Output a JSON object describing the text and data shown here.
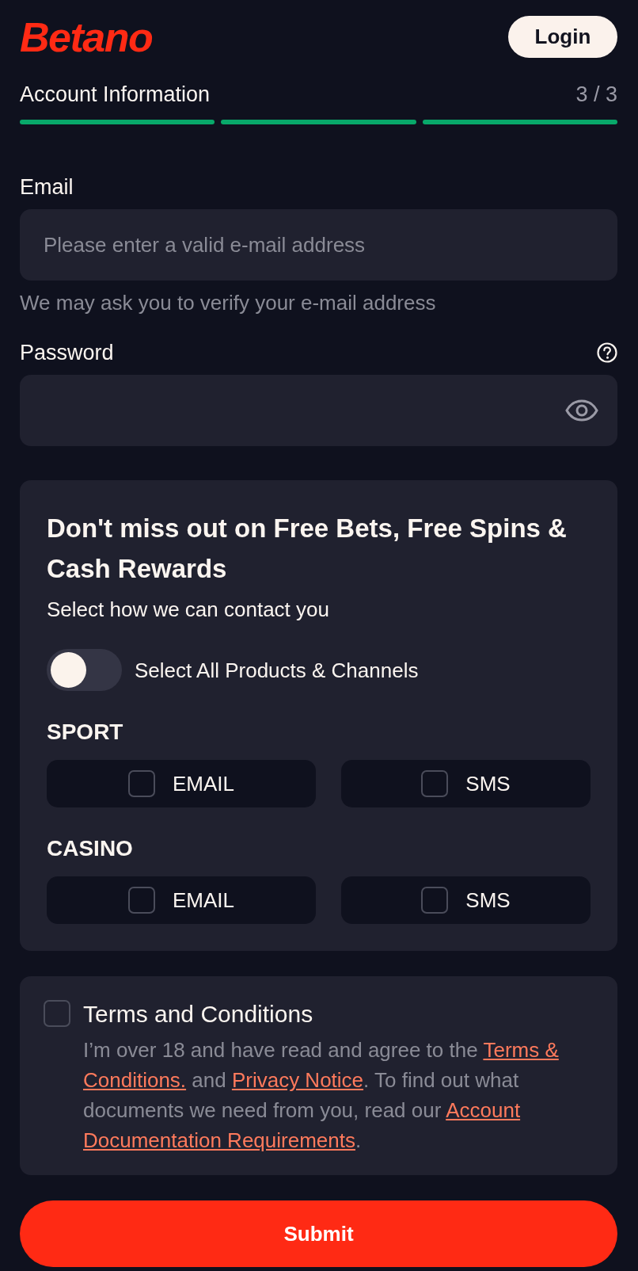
{
  "header": {
    "logo": "Betano",
    "login_button": "Login"
  },
  "progress": {
    "title": "Account Information",
    "counter": "3 / 3",
    "steps": [
      {
        "done": true
      },
      {
        "done": true
      },
      {
        "done": true
      }
    ]
  },
  "fields": [
    {
      "kind": "email",
      "label": "Email",
      "placeholder": "Please enter a valid e-mail address",
      "hint": "We may ask you to verify your e-mail address"
    },
    {
      "kind": "password",
      "label": "Password"
    }
  ],
  "promo": {
    "title": "Don't miss out on Free Bets, Free Spins & Cash Rewards",
    "subtitle": "Select how we can contact you",
    "toggle": {
      "label": "Select All Products & Channels",
      "on": false
    },
    "groups": [
      {
        "name": "SPORT",
        "channels": [
          {
            "label": "EMAIL",
            "checked": false
          },
          {
            "label": "SMS",
            "checked": false
          }
        ]
      },
      {
        "name": "CASINO",
        "channels": [
          {
            "label": "EMAIL",
            "checked": false
          },
          {
            "label": "SMS",
            "checked": false
          }
        ]
      }
    ]
  },
  "terms": {
    "title": "Terms and Conditions",
    "checked": false,
    "text": [
      {
        "kind": "text",
        "text": "I’m over 18 and have read and agree to the "
      },
      {
        "kind": "link",
        "text": "Terms &"
      },
      {
        "kind": "link",
        "text": "Conditions."
      },
      {
        "kind": "text",
        "text": " and "
      },
      {
        "kind": "link",
        "text": "Privacy Notice"
      },
      {
        "kind": "text",
        "text": ". To find out what documents we need from you, read our "
      },
      {
        "kind": "link",
        "text": "Account"
      },
      {
        "kind": "link",
        "text": "Documentation Requirements"
      },
      {
        "kind": "text",
        "text": "."
      }
    ]
  },
  "submit_button": "Submit"
}
